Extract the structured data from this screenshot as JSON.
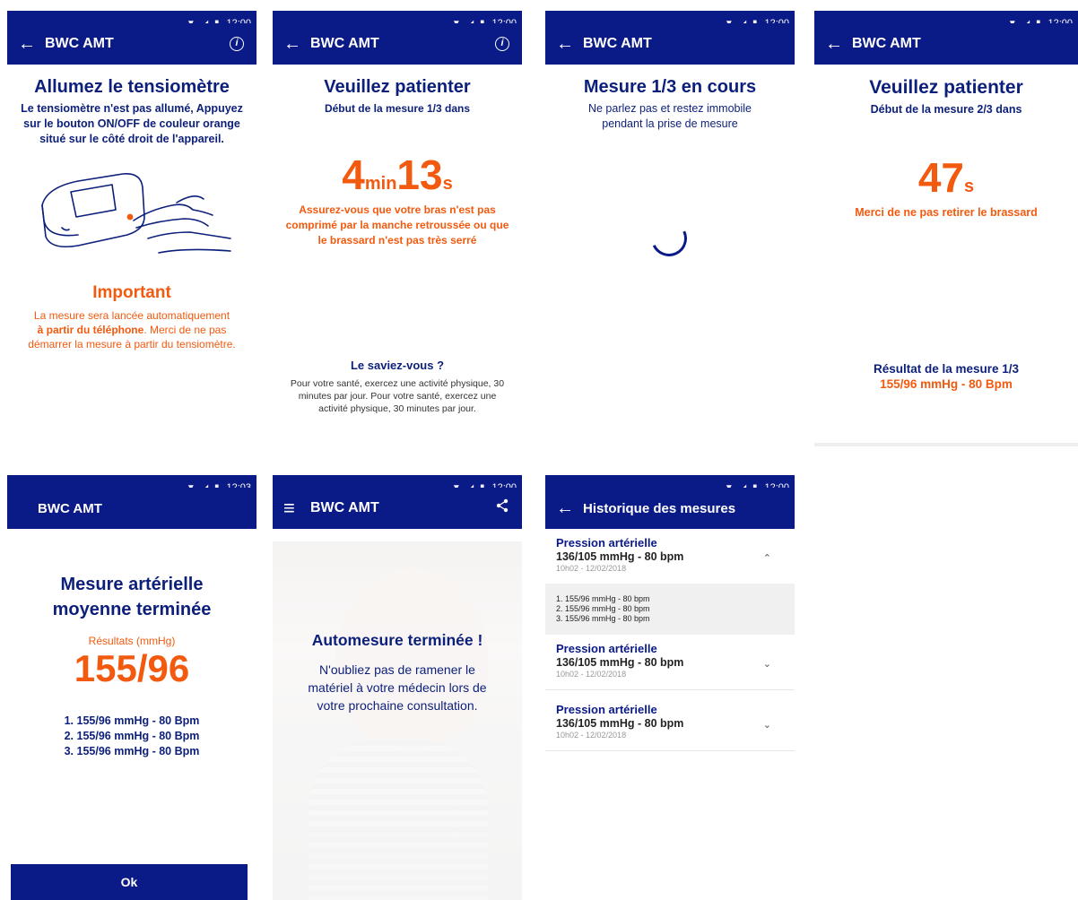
{
  "status_time": "12:00",
  "status_time_alt": "12:03",
  "status_icons": "▼ ◢ ▮",
  "brand_color": "#0a1a86",
  "accent_color": "#f25a0f",
  "s1": {
    "app_title": "BWC AMT",
    "back_icon": "←",
    "info_icon": "i",
    "heading": "Allumez le tensiomètre",
    "desc": "Le tensiomètre n'est pas allumé, Appuyez sur le bouton ON/OFF de couleur orange situé sur le côté droit de l'appareil.",
    "important_title": "Important",
    "important_l1": "La mesure sera lancée automatiquement",
    "important_bold": "à partir du téléphone",
    "important_l2": ". Merci de ne pas démarrer la mesure à partir du tensiomètre."
  },
  "s2": {
    "app_title": "BWC AMT",
    "back_icon": "←",
    "info_icon": "i",
    "heading": "Veuillez patienter",
    "sub": "Début de la mesure 1/3 dans",
    "minutes": "4",
    "min_unit": "min",
    "seconds": "13",
    "sec_unit": "s",
    "warning": "Assurez-vous que votre bras n'est pas comprimé par la manche retroussée ou que le brassard n'est pas très serré",
    "tip_title": "Le saviez-vous ?",
    "tip_text": "Pour votre santé, exercez une activité physique, 30 minutes par jour. Pour votre santé, exercez une activité physique, 30 minutes par jour."
  },
  "s3": {
    "app_title": "BWC AMT",
    "back_icon": "←",
    "heading": "Mesure 1/3 en cours",
    "sub": "Ne parlez pas et restez immobile pendant la prise de mesure"
  },
  "s4": {
    "app_title": "BWC AMT",
    "back_icon": "←",
    "heading": "Veuillez patienter",
    "sub": "Début de la mesure 2/3 dans",
    "seconds": "47",
    "sec_unit": "s",
    "warning": "Merci de ne pas retirer le brassard",
    "result_title": "Résultat de la mesure 1/3",
    "result_value": "155/96 mmHg - 80 Bpm"
  },
  "s5": {
    "app_title": "BWC AMT",
    "heading_l1": "Mesure artérielle",
    "heading_l2": "moyenne terminée",
    "results_label": "Résultats (mmHg)",
    "big_value": "155/96",
    "lines": [
      "1. 155/96 mmHg - 80 Bpm",
      "2. 155/96 mmHg - 80 Bpm",
      "3. 155/96 mmHg - 80 Bpm"
    ],
    "ok_label": "Ok"
  },
  "s6": {
    "app_title": "BWC AMT",
    "menu_icon": "≡",
    "share_icon": "share",
    "heading": "Automesure terminée !",
    "body": "N'oubliez pas de ramener le matériel à votre médecin lors de votre prochaine consultation."
  },
  "s7": {
    "app_title": "Historique des mesures",
    "back_icon": "←",
    "groups": [
      {
        "title": "Pression artérielle",
        "value": "136/105 mmHg - 80 bpm",
        "date": "10h02 - 12/02/2018",
        "chevron": "⌃"
      },
      {
        "title": "Pression artérielle",
        "value": "136/105 mmHg - 80 bpm",
        "date": "10h02 - 12/02/2018",
        "chevron": "⌄"
      },
      {
        "title": "Pression artérielle",
        "value": "136/105 mmHg - 80 bpm",
        "date": "10h02 - 12/02/2018",
        "chevron": "⌄"
      }
    ],
    "details": [
      "1. 155/96 mmHg - 80 bpm",
      "2. 155/96 mmHg - 80 bpm",
      "3. 155/96 mmHg - 80 bpm"
    ]
  }
}
